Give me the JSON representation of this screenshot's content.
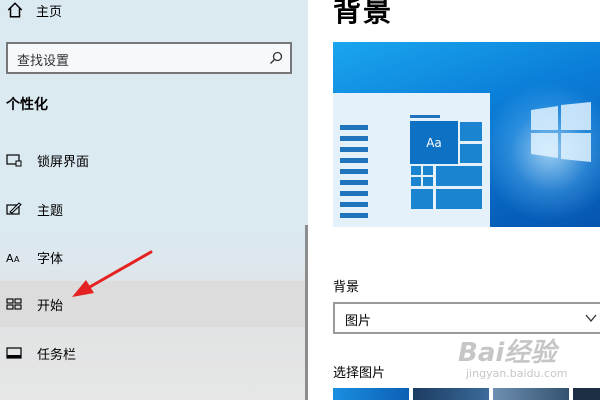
{
  "sidebar": {
    "home_label": "主页",
    "search_placeholder": "查找设置",
    "section_title": "个性化",
    "items": [
      {
        "label": "锁屏界面",
        "icon": "lock-screen-icon"
      },
      {
        "label": "主题",
        "icon": "theme-icon"
      },
      {
        "label": "字体",
        "icon": "font-icon"
      },
      {
        "label": "开始",
        "icon": "start-icon",
        "active": true
      },
      {
        "label": "任务栏",
        "icon": "taskbar-icon"
      }
    ]
  },
  "main": {
    "title": "背景",
    "preview_tile_text": "Aa",
    "background_label": "背景",
    "background_value": "图片",
    "choose_picture_label": "选择图片"
  },
  "watermark": {
    "text": "Bai经验",
    "sub": "jingyan.baidu.com"
  },
  "colors": {
    "sidebar_bg": "#dbe9f1",
    "active_item_bg": "#dcdcdc",
    "accent": "#0078d7",
    "annotation_arrow": "#e52222"
  }
}
